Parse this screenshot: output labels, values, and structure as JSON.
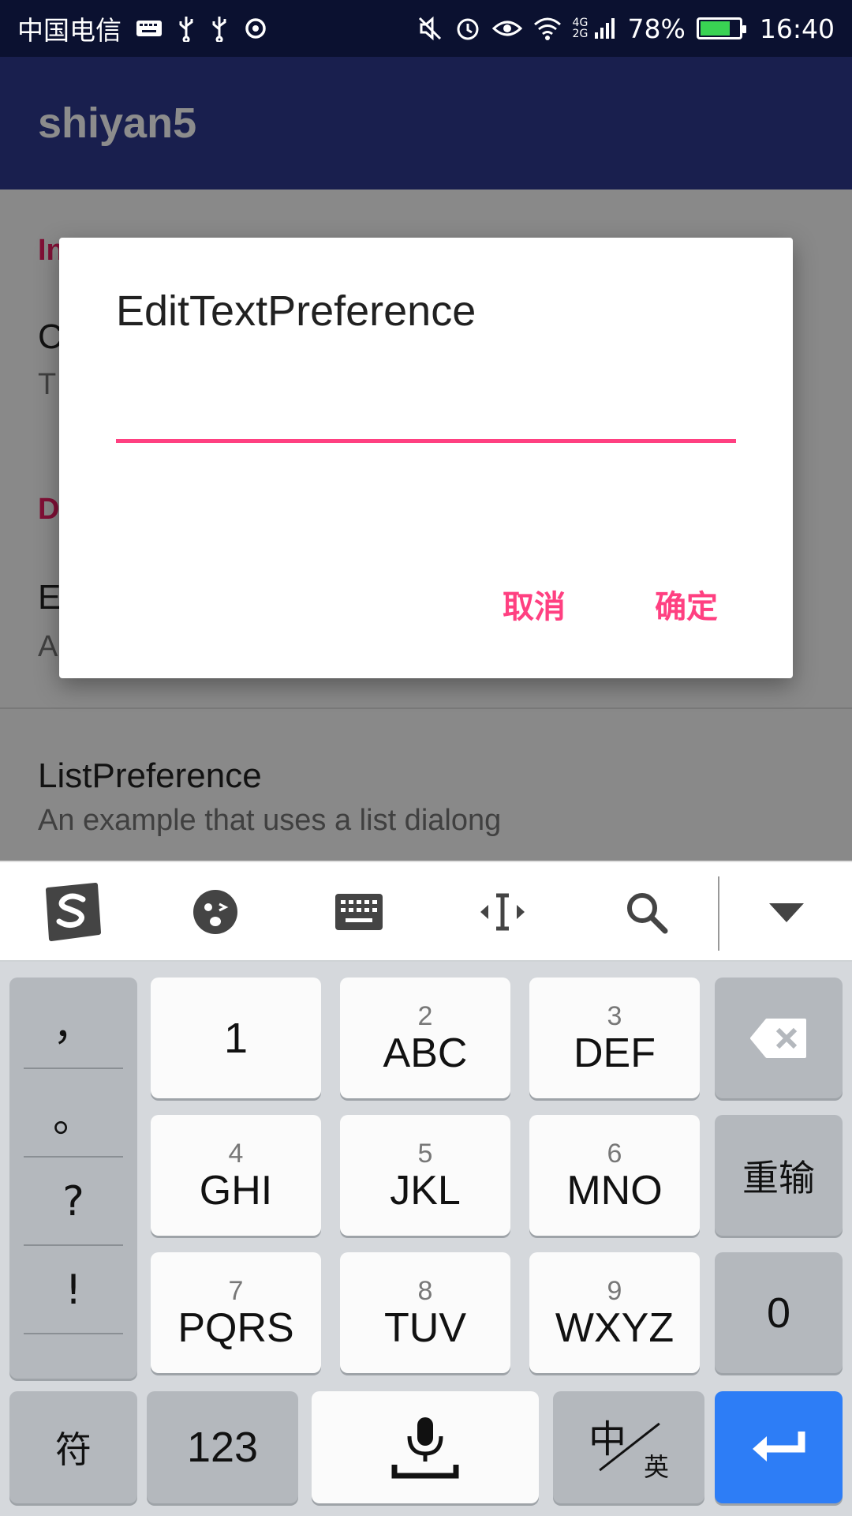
{
  "status_bar": {
    "carrier": "中国电信",
    "battery_percent": "78%",
    "battery_level": 0.78,
    "time": "16:40",
    "network": "4G 2G",
    "left_icons": [
      "keyboard-icon",
      "usb-icon",
      "usb-icon",
      "sync-icon"
    ],
    "right_icons": [
      "mute-icon",
      "alarm-icon",
      "eye-icon",
      "wifi-icon",
      "signal-icon",
      "battery-icon"
    ]
  },
  "app_bar": {
    "title": "shiyan5"
  },
  "preferences": {
    "category_1": "In",
    "item_1_title": "C",
    "item_1_summary": "T",
    "category_2": "D",
    "item_2_title": "E",
    "item_2_summary": "A",
    "list_pref_title": "ListPreference",
    "list_pref_summary": "An example that uses a list dialong"
  },
  "dialog": {
    "title": "EditTextPreference",
    "input_value": "",
    "cancel_label": "取消",
    "ok_label": "确定"
  },
  "ime_toolbar": {
    "icons": [
      "sogou-logo-icon",
      "emoji-icon",
      "keyboard-icon",
      "cursor-move-icon",
      "search-icon",
      "collapse-icon"
    ]
  },
  "keyboard": {
    "punctuation": [
      "，",
      "。",
      "?",
      "!"
    ],
    "keys": [
      {
        "num": "",
        "letters": "1"
      },
      {
        "num": "2",
        "letters": "ABC"
      },
      {
        "num": "3",
        "letters": "DEF"
      },
      {
        "num": "4",
        "letters": "GHI"
      },
      {
        "num": "5",
        "letters": "JKL"
      },
      {
        "num": "6",
        "letters": "MNO"
      },
      {
        "num": "7",
        "letters": "PQRS"
      },
      {
        "num": "8",
        "letters": "TUV"
      },
      {
        "num": "9",
        "letters": "WXYZ"
      }
    ],
    "reenter": "重输",
    "zero": "0",
    "symbols": "符",
    "num_mode": "123",
    "lang_cn": "中",
    "lang_en": "英"
  },
  "colors": {
    "app_bar": "#2f3a8f",
    "status_bar": "#0b1130",
    "accent": "#ff4081",
    "enter_key": "#2d7df6"
  }
}
